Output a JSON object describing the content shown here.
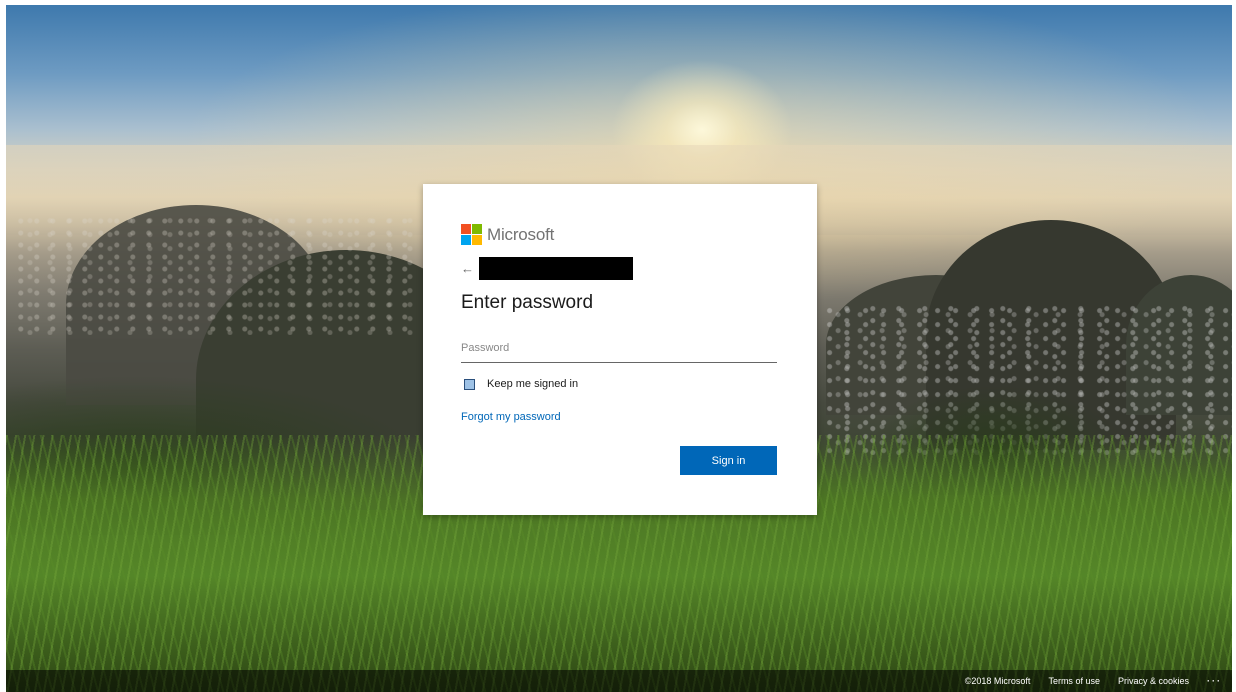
{
  "signin": {
    "logo": {
      "text": "Microsoft",
      "colors": [
        "#f25022",
        "#7fba00",
        "#00a4ef",
        "#ffb900"
      ]
    },
    "back_icon": "←",
    "title": "Enter password",
    "password_placeholder": "Password",
    "keep_signed_in_label": "Keep me signed in",
    "keep_signed_in_checked": true,
    "forgot_link": "Forgot my password",
    "signin_button": "Sign in",
    "accent_color": "#0067b8"
  },
  "footer": {
    "copyright": "©2018 Microsoft",
    "terms": "Terms of use",
    "privacy": "Privacy & cookies",
    "more": "···"
  }
}
